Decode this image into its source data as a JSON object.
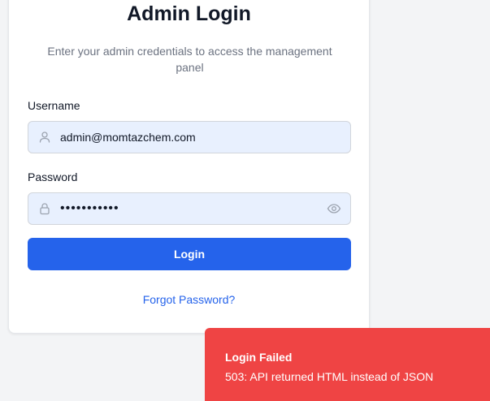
{
  "login": {
    "title": "Admin Login",
    "subtitle": "Enter your admin credentials to access the management panel",
    "username_label": "Username",
    "username_value": "admin@momtazchem.com",
    "password_label": "Password",
    "password_value": "•••••••••••",
    "login_button": "Login",
    "forgot_link": "Forgot Password?"
  },
  "icons": {
    "username": "user-icon",
    "password": "lock-icon",
    "toggle": "eye-icon"
  },
  "toast": {
    "title": "Login Failed",
    "message": "503: API returned HTML instead of JSON"
  },
  "colors": {
    "primary": "#2563eb",
    "error": "#ef4444",
    "field_bg": "#e8f0fe"
  }
}
